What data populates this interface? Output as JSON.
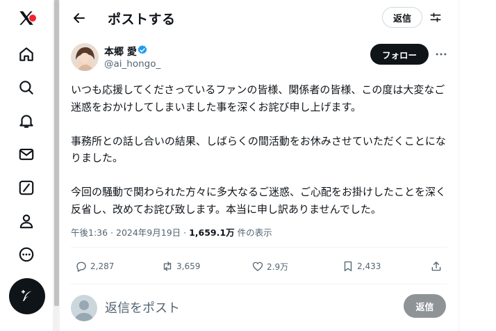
{
  "header": {
    "title": "ポストする",
    "reply_button": "返信"
  },
  "sidebar": {
    "icons": [
      "x-logo-icon",
      "home-icon",
      "search-icon",
      "notifications-icon",
      "messages-icon",
      "grok-icon",
      "profile-icon",
      "more-circle-icon",
      "post-compose-icon"
    ]
  },
  "tweet": {
    "display_name": "本郷 愛",
    "handle": "@ai_hongo_",
    "follow_label": "フォロー",
    "body": "いつも応援してくださっているファンの皆様、関係者の皆様、この度は大変なご迷惑をおかけしてしまいました事を深くお詫び申し上げます。\n\n事務所との話し合いの結果、しばらくの間活動をお休みさせていただくことになりました。\n\n今回の騒動で関わられた方々に多大なるご迷惑、ご心配をお掛けしたことを深く反省し、改めてお詫び致します。本当に申し訳ありませんでした。",
    "time": "午後1:36 · 2024年9月19日 · ",
    "views": "1,659.1万",
    "views_suffix": " 件の表示",
    "stats": {
      "replies": "2,287",
      "reposts": "3,659",
      "likes": "2.9万",
      "bookmarks": "2,433"
    }
  },
  "reply": {
    "placeholder": "返信をポスト",
    "button": "返信"
  },
  "colors": {
    "text": "#0f1419",
    "secondary": "#536471",
    "verified": "#1d9bf0",
    "accent_badge": "#f4212e"
  }
}
